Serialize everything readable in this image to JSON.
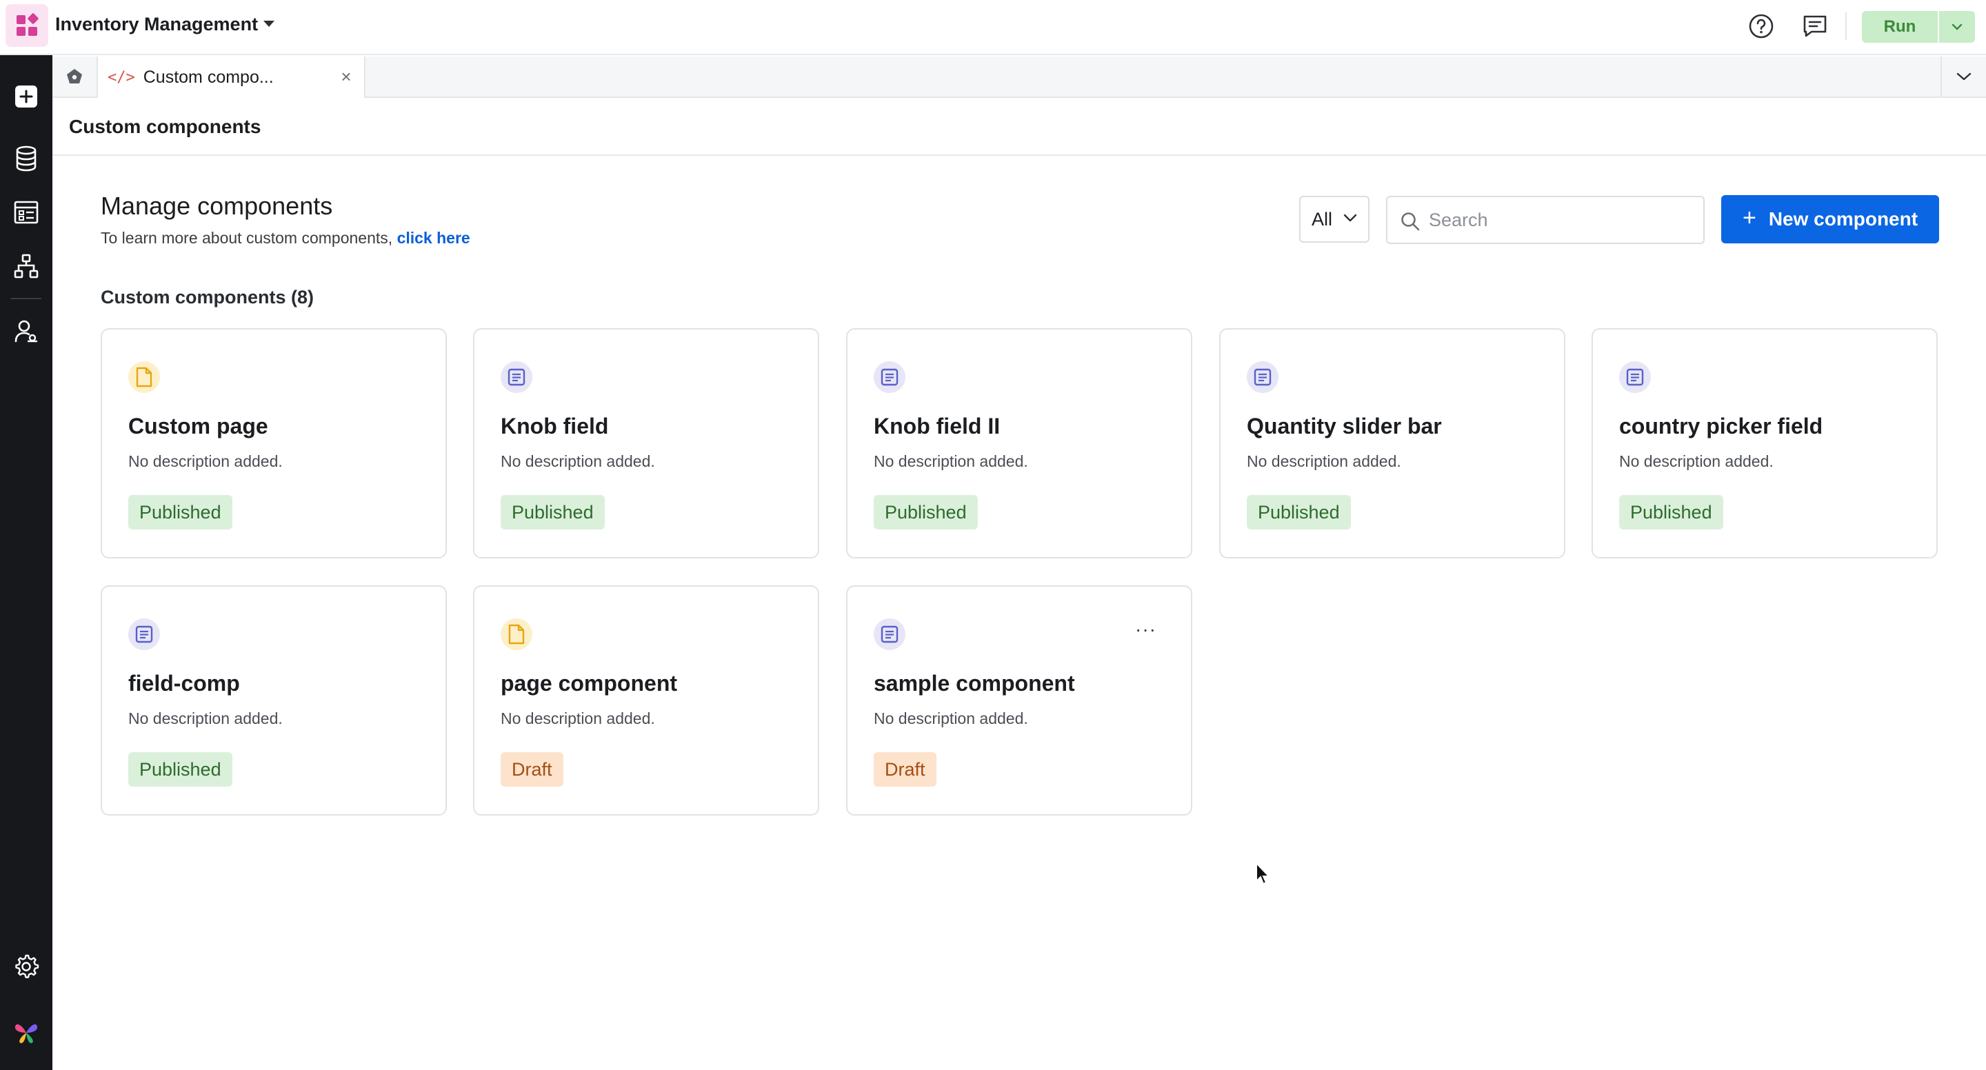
{
  "app": {
    "title": "Inventory Management"
  },
  "topbar": {
    "run_label": "Run",
    "help_icon": "help-circle-icon",
    "comments_icon": "comment-icon"
  },
  "rail": {
    "items": [
      {
        "icon": "plus-square-icon"
      },
      {
        "icon": "database-icon"
      },
      {
        "icon": "pages-icon"
      },
      {
        "icon": "workflow-icon"
      },
      {
        "icon": "user-settings-icon"
      }
    ],
    "bottom": [
      {
        "icon": "gear-icon"
      },
      {
        "icon": "brand-logo-icon"
      }
    ]
  },
  "tabs": {
    "home_icon": "home-icon",
    "active": {
      "label": "Custom compo...",
      "icon_text": "</>"
    },
    "close_glyph": "×"
  },
  "page": {
    "title": "Custom components"
  },
  "manage": {
    "title": "Manage components",
    "subtitle_text": "To learn more about custom components, ",
    "subtitle_link": "click here",
    "filter_value": "All",
    "search_placeholder": "Search",
    "new_button_plus": "+",
    "new_button_label": "New component",
    "section_label": "Custom components (8)"
  },
  "components": [
    {
      "name": "Custom page",
      "description": "No description added.",
      "status": "Published",
      "kind": "page"
    },
    {
      "name": "Knob field",
      "description": "No description added.",
      "status": "Published",
      "kind": "field"
    },
    {
      "name": "Knob field II",
      "description": "No description added.",
      "status": "Published",
      "kind": "field"
    },
    {
      "name": "Quantity slider bar",
      "description": "No description added.",
      "status": "Published",
      "kind": "field"
    },
    {
      "name": "country picker field",
      "description": "No description added.",
      "status": "Published",
      "kind": "field"
    },
    {
      "name": "field-comp",
      "description": "No description added.",
      "status": "Published",
      "kind": "field"
    },
    {
      "name": "page component",
      "description": "No description added.",
      "status": "Draft",
      "kind": "page"
    },
    {
      "name": "sample component",
      "description": "No description added.",
      "status": "Draft",
      "kind": "field",
      "more": "···"
    }
  ],
  "colors": {
    "accent": "#0b66e4",
    "published_bg": "#dbf0db",
    "draft_bg": "#fde2cc",
    "rail_bg": "#16181b"
  }
}
